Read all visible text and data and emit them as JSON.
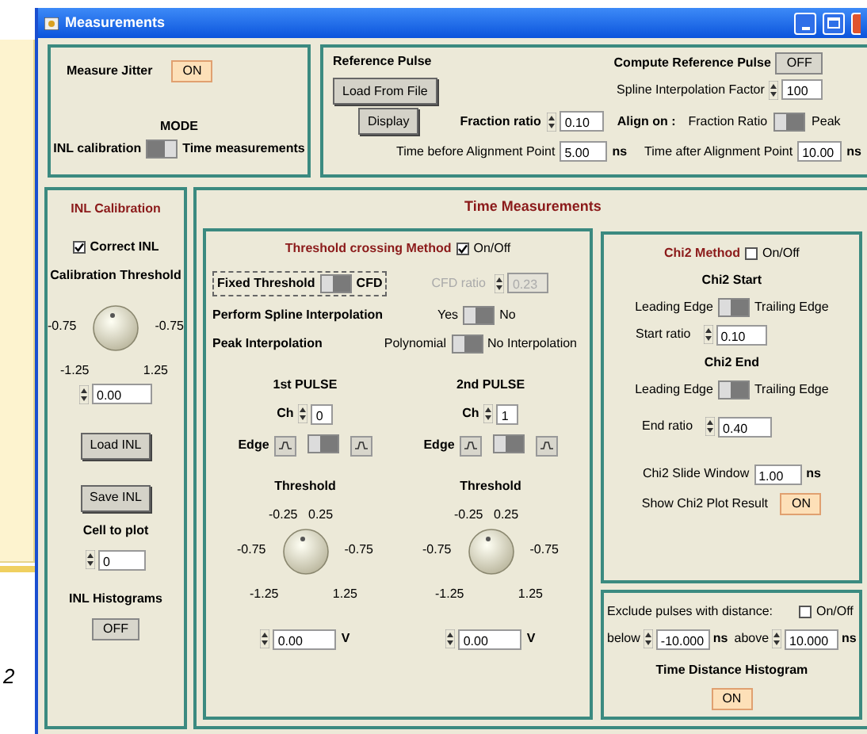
{
  "background": {
    "slide_number": "2"
  },
  "window": {
    "title": "Measurements"
  },
  "jitter_panel": {
    "measure_jitter": {
      "label": "Measure Jitter",
      "button": "ON",
      "on": true
    },
    "mode": {
      "title": "MODE",
      "left": "INL calibration",
      "right": "Time measurements",
      "on": false
    }
  },
  "reference_pulse": {
    "title": "Reference Pulse",
    "load_button": "Load From File",
    "display_button": "Display",
    "compute": {
      "label": "Compute Reference Pulse",
      "button": "OFF",
      "on": false
    },
    "spline_factor": {
      "label": "Spline Interpolation Factor",
      "value": "100"
    },
    "fraction_ratio": {
      "label": "Fraction ratio",
      "value": "0.10"
    },
    "align_on": {
      "label": "Align on :",
      "left": "Fraction Ratio",
      "right": "Peak",
      "on": true
    },
    "time_before": {
      "label": "Time before Alignment Point",
      "value": "5.00",
      "unit": "ns"
    },
    "time_after": {
      "label": "Time after Alignment Point",
      "value": "10.00",
      "unit": "ns"
    }
  },
  "inl_calibration": {
    "title": "INL Calibration",
    "correct_inl": {
      "label": "Correct INL",
      "checked": true
    },
    "calibration_threshold": {
      "label": "Calibration Threshold",
      "knob_labels": [
        "-0.75",
        "-0.75",
        "-1.25",
        "1.25"
      ],
      "value": "0.00"
    },
    "load_button": "Load INL",
    "save_button": "Save INL",
    "cell_to_plot": {
      "label": "Cell to plot",
      "value": "0"
    },
    "histograms": {
      "label": "INL Histograms",
      "button": "OFF",
      "on": false
    }
  },
  "time_measurements": {
    "title": "Time Measurements",
    "threshold_method": {
      "title": "Threshold crossing Method",
      "checkbox": "On/Off",
      "checked": true,
      "fixed_cfd": {
        "left": "Fixed Threshold",
        "right": "CFD",
        "on": true
      },
      "cfd_ratio": {
        "label": "CFD ratio",
        "value": "0.23",
        "disabled": true
      },
      "spline": {
        "label": "Perform Spline Interpolation",
        "left": "Yes",
        "right": "No",
        "on": true
      },
      "peak": {
        "label": "Peak Interpolation",
        "left": "Polynomial",
        "right": "No Interpolation",
        "on": true
      },
      "pulses": [
        {
          "title": "1st PULSE",
          "ch_label": "Ch",
          "ch": "0",
          "edge_label": "Edge",
          "edge_on": true,
          "threshold_label": "Threshold",
          "knob_labels": [
            "-0.25",
            "0.25",
            "-0.75",
            "-0.75",
            "-1.25",
            "1.25"
          ],
          "value": "0.00",
          "unit": "V"
        },
        {
          "title": "2nd  PULSE",
          "ch_label": "Ch",
          "ch": "1",
          "edge_label": "Edge",
          "edge_on": true,
          "threshold_label": "Threshold",
          "knob_labels": [
            "-0.25",
            "0.25",
            "-0.75",
            "-0.75",
            "-1.25",
            "1.25"
          ],
          "value": "0.00",
          "unit": "V"
        }
      ]
    },
    "chi2": {
      "title": "Chi2 Method",
      "checkbox": "On/Off",
      "checked": false,
      "start_title": "Chi2 Start",
      "start_switch": {
        "left": "Leading Edge",
        "right": "Trailing Edge",
        "on": true
      },
      "start_ratio": {
        "label": "Start ratio",
        "value": "0.10"
      },
      "end_title": "Chi2 End",
      "end_switch": {
        "left": "Leading Edge",
        "right": "Trailing Edge",
        "on": true
      },
      "end_ratio": {
        "label": "End ratio",
        "value": "0.40"
      },
      "slide_window": {
        "label": "Chi2 Slide Window",
        "value": "1.00",
        "unit": "ns"
      },
      "show_plot": {
        "label": "Show Chi2 Plot Result",
        "button": "ON",
        "on": true
      }
    },
    "exclude": {
      "label": "Exclude pulses with distance:",
      "checkbox": "On/Off",
      "checked": false,
      "below": {
        "label": "below",
        "value": "-10.000",
        "unit": "ns"
      },
      "above": {
        "label": "above",
        "value": "10.000",
        "unit": "ns"
      },
      "histogram": {
        "title": "Time Distance Histogram",
        "button": "ON",
        "on": true
      }
    }
  }
}
